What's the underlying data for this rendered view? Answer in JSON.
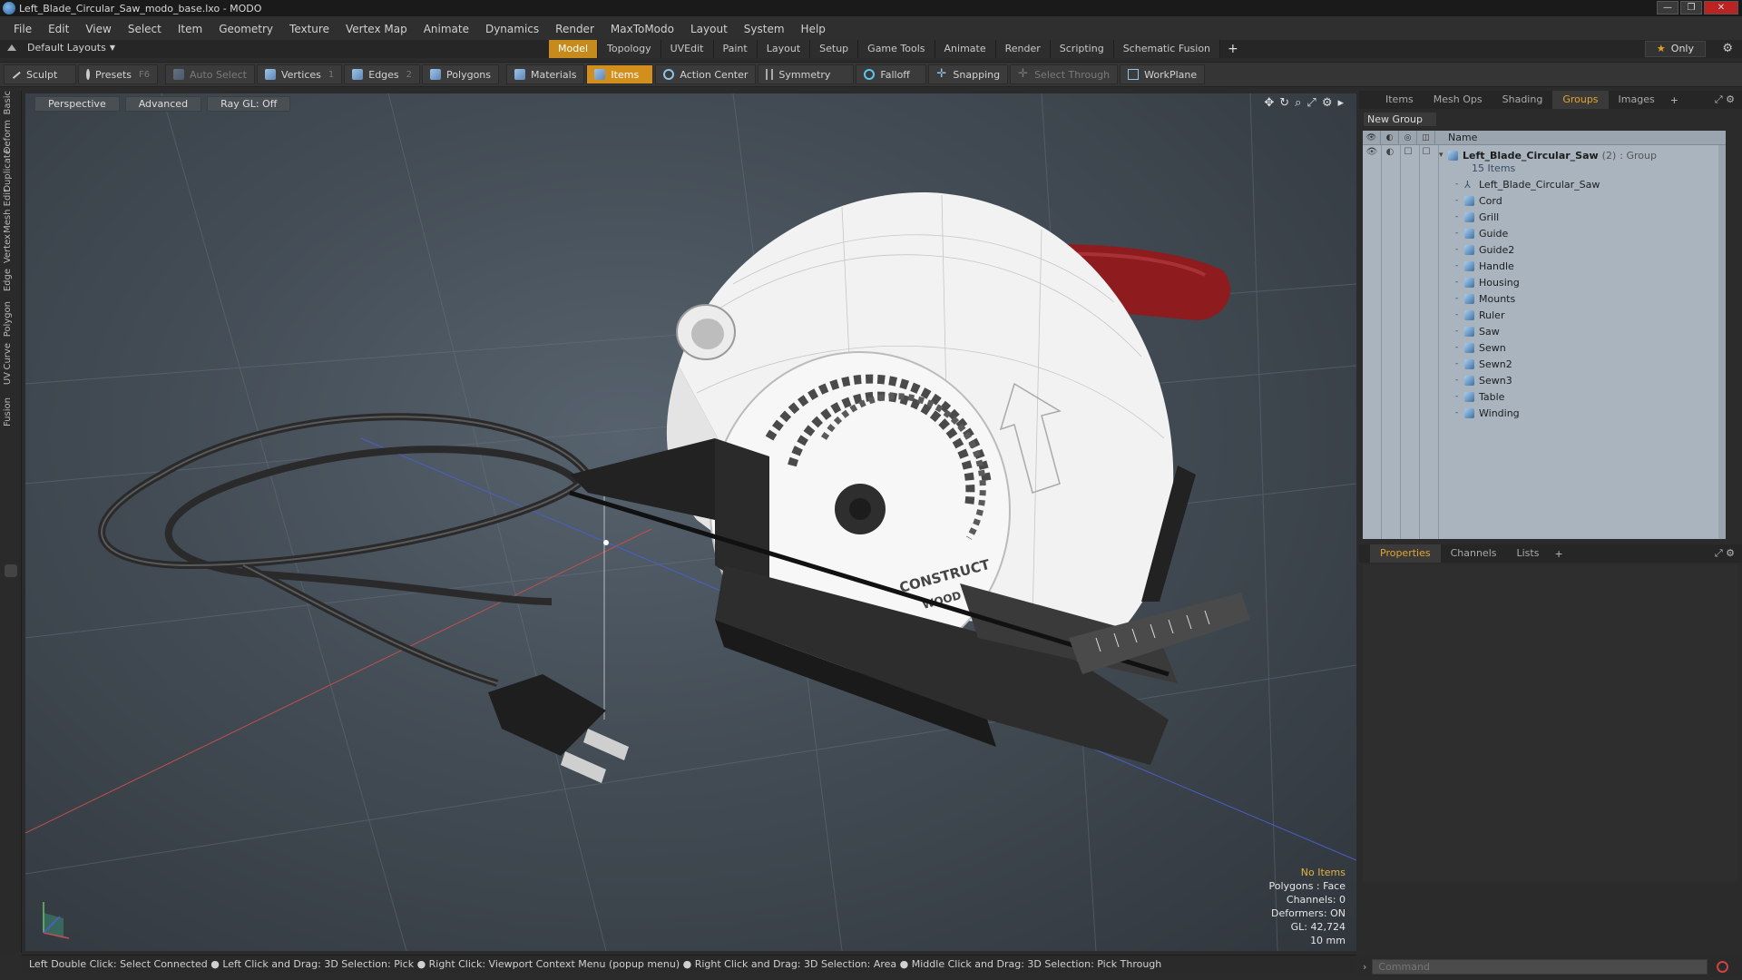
{
  "window": {
    "title": "Left_Blade_Circular_Saw_modo_base.lxo - MODO"
  },
  "menu": [
    "File",
    "Edit",
    "View",
    "Select",
    "Item",
    "Geometry",
    "Texture",
    "Vertex Map",
    "Animate",
    "Dynamics",
    "Render",
    "MaxToModo",
    "Layout",
    "System",
    "Help"
  ],
  "layouts_label": "Default Layouts",
  "tabs": [
    "Model",
    "Topology",
    "UVEdit",
    "Paint",
    "Layout",
    "Setup",
    "Game Tools",
    "Animate",
    "Render",
    "Scripting",
    "Schematic Fusion"
  ],
  "active_tab": "Model",
  "only_label": "Only",
  "toolbar": {
    "sculpt": "Sculpt",
    "presets": "Presets",
    "presets_key": "F6",
    "auto_select": "Auto Select",
    "vertices": "Vertices",
    "vertices_key": "1",
    "edges": "Edges",
    "edges_key": "2",
    "polygons": "Polygons",
    "materials": "Materials",
    "items": "Items",
    "action_center": "Action Center",
    "symmetry": "Symmetry",
    "falloff": "Falloff",
    "snapping": "Snapping",
    "select_through": "Select Through",
    "workplane": "WorkPlane"
  },
  "left_tabs": [
    "Basic",
    "Deform",
    "Duplicate",
    "Mesh Edit",
    "Vertex",
    "Edge",
    "Polygon",
    "Curve",
    "UV",
    "Fusion"
  ],
  "viewport": {
    "view_mode": "Perspective",
    "shading": "Advanced",
    "raygl": "Ray GL: Off",
    "model_text_1": "CONSTRUCT",
    "model_text_2": "WOOD",
    "info": {
      "items": "No Items",
      "polygons": "Polygons : Face",
      "channels": "Channels: 0",
      "deformers": "Deformers: ON",
      "gl": "GL: 42,724",
      "scale": "10 mm"
    }
  },
  "statusbar": "Left Double Click: Select Connected ● Left Click and Drag: 3D Selection: Pick ● Right Click: Viewport Context Menu (popup menu) ● Right Click and Drag: 3D Selection: Area ● Middle Click and Drag: 3D Selection: Pick Through",
  "panel_tabs": [
    "Items",
    "Mesh Ops",
    "Shading",
    "Groups",
    "Images"
  ],
  "active_panel_tab": "Groups",
  "new_group": "New Group",
  "groups": {
    "name_header": "Name",
    "root": {
      "name": "Left_Blade_Circular_Saw",
      "count": "(2)",
      "type": ": Group",
      "sub": "15 Items"
    },
    "items": [
      "Left_Blade_Circular_Saw",
      "Cord",
      "Grill",
      "Guide",
      "Guide2",
      "Handle",
      "Housing",
      "Mounts",
      "Ruler",
      "Saw",
      "Sewn",
      "Sewn2",
      "Sewn3",
      "Table",
      "Winding"
    ]
  },
  "props_tabs": [
    "Properties",
    "Channels",
    "Lists"
  ],
  "active_props_tab": "Properties",
  "command_placeholder": "Command",
  "colors": {
    "accent": "#d38f1d",
    "handle_red": "#8e1c1f",
    "body_white": "#f2f2f2"
  }
}
